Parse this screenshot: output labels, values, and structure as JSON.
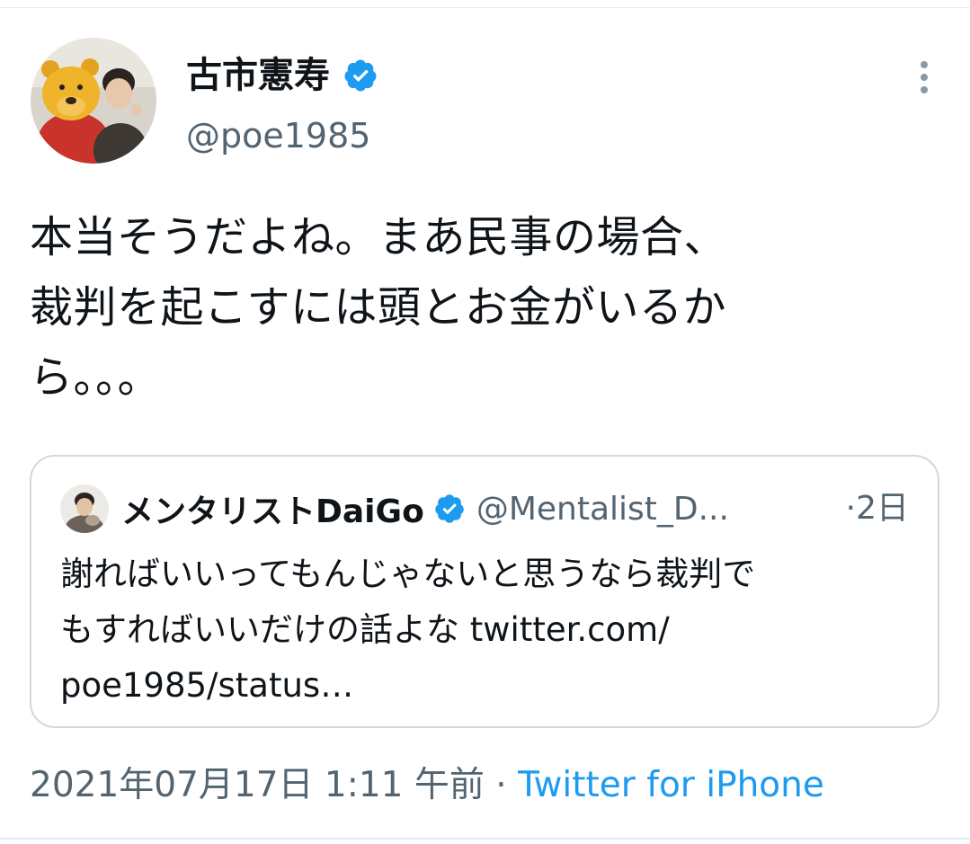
{
  "tweet": {
    "author_name": "古市憲寿",
    "author_handle": "@poe1985",
    "text": "本当そうだよね。まあ民事の場合、\n裁判を起こすには頭とお金がいるか\nら。。。",
    "timestamp": "2021年07月17日 1:11 午前",
    "separator": "·",
    "source": "Twitter for iPhone"
  },
  "quoted_tweet": {
    "author_name": "メンタリストDaiGo",
    "author_handle": "@Mentalist_D...",
    "time_separator": "·",
    "time": "2日",
    "text": "謝ればいいってもんじゃないと思うなら裁判で\nもすればいいだけの話よな ",
    "link_text": "twitter.com/\npoe1985/status…"
  },
  "icons": {
    "verified_badge": "verified-badge-icon",
    "more_menu": "more-vertical-icon"
  },
  "colors": {
    "accent": "#1d9bf0",
    "secondary_text": "#536471",
    "border": "#cfd9de"
  }
}
